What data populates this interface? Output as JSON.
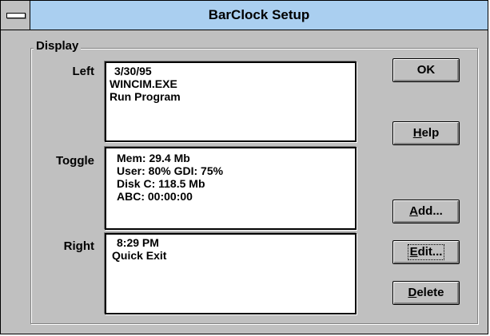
{
  "window": {
    "title": "BarClock Setup",
    "titlebar_color": "#aacff0",
    "face_color": "#c0c0c0"
  },
  "display_group": {
    "label": "Display",
    "left": {
      "label": "Left",
      "lines": [
        "3/30/95",
        "WINCIM.EXE",
        "Run Program"
      ]
    },
    "toggle": {
      "label": "Toggle",
      "lines": [
        "Mem: 29.4 Mb",
        "User: 80% GDI: 75%",
        "Disk C: 118.5 Mb",
        "ABC: 00:00:00"
      ]
    },
    "right": {
      "label": "Right",
      "lines": [
        "8:29 PM",
        "Quick Exit"
      ]
    }
  },
  "buttons": {
    "ok": {
      "label": "OK"
    },
    "help": {
      "mnemonic": "H",
      "rest": "elp"
    },
    "add": {
      "mnemonic": "A",
      "rest": "dd..."
    },
    "edit": {
      "mnemonic": "E",
      "rest": "dit..."
    },
    "delete": {
      "mnemonic": "D",
      "rest": "elete"
    }
  }
}
